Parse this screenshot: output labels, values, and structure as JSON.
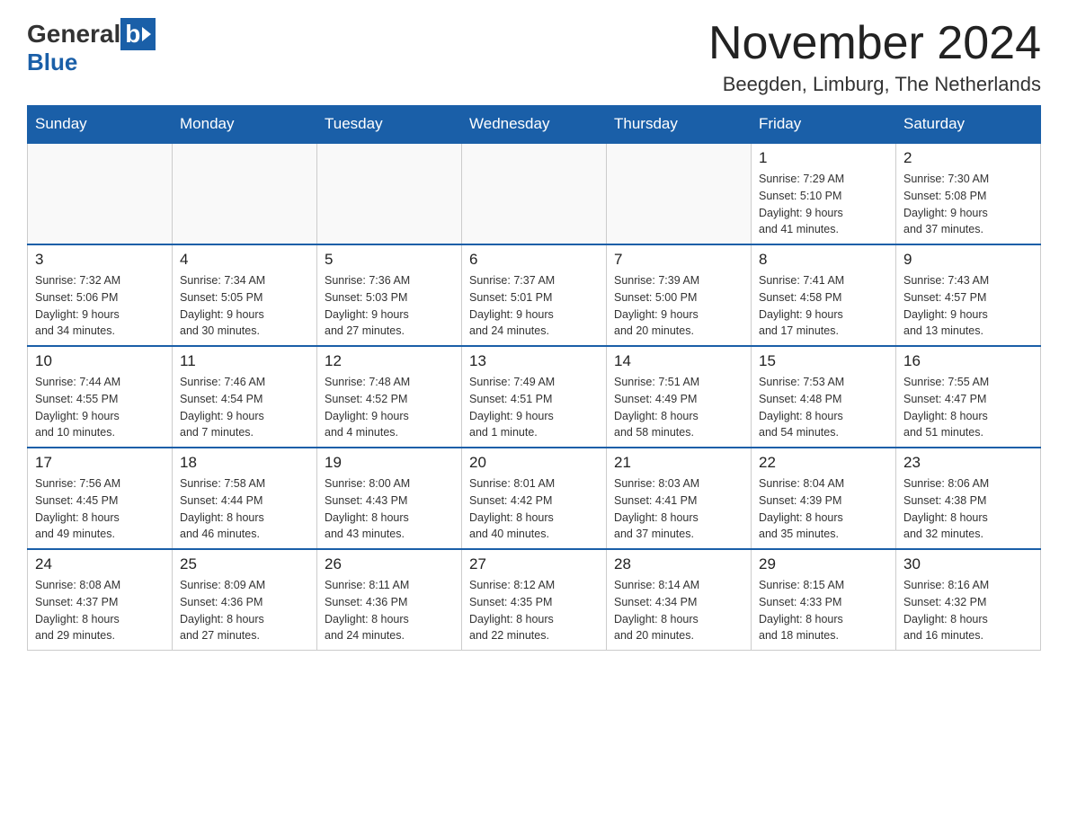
{
  "header": {
    "logo_general": "General",
    "logo_blue": "Blue",
    "month_title": "November 2024",
    "location": "Beegden, Limburg, The Netherlands"
  },
  "days_of_week": [
    "Sunday",
    "Monday",
    "Tuesday",
    "Wednesday",
    "Thursday",
    "Friday",
    "Saturday"
  ],
  "weeks": [
    [
      {
        "day": "",
        "info": ""
      },
      {
        "day": "",
        "info": ""
      },
      {
        "day": "",
        "info": ""
      },
      {
        "day": "",
        "info": ""
      },
      {
        "day": "",
        "info": ""
      },
      {
        "day": "1",
        "info": "Sunrise: 7:29 AM\nSunset: 5:10 PM\nDaylight: 9 hours\nand 41 minutes."
      },
      {
        "day": "2",
        "info": "Sunrise: 7:30 AM\nSunset: 5:08 PM\nDaylight: 9 hours\nand 37 minutes."
      }
    ],
    [
      {
        "day": "3",
        "info": "Sunrise: 7:32 AM\nSunset: 5:06 PM\nDaylight: 9 hours\nand 34 minutes."
      },
      {
        "day": "4",
        "info": "Sunrise: 7:34 AM\nSunset: 5:05 PM\nDaylight: 9 hours\nand 30 minutes."
      },
      {
        "day": "5",
        "info": "Sunrise: 7:36 AM\nSunset: 5:03 PM\nDaylight: 9 hours\nand 27 minutes."
      },
      {
        "day": "6",
        "info": "Sunrise: 7:37 AM\nSunset: 5:01 PM\nDaylight: 9 hours\nand 24 minutes."
      },
      {
        "day": "7",
        "info": "Sunrise: 7:39 AM\nSunset: 5:00 PM\nDaylight: 9 hours\nand 20 minutes."
      },
      {
        "day": "8",
        "info": "Sunrise: 7:41 AM\nSunset: 4:58 PM\nDaylight: 9 hours\nand 17 minutes."
      },
      {
        "day": "9",
        "info": "Sunrise: 7:43 AM\nSunset: 4:57 PM\nDaylight: 9 hours\nand 13 minutes."
      }
    ],
    [
      {
        "day": "10",
        "info": "Sunrise: 7:44 AM\nSunset: 4:55 PM\nDaylight: 9 hours\nand 10 minutes."
      },
      {
        "day": "11",
        "info": "Sunrise: 7:46 AM\nSunset: 4:54 PM\nDaylight: 9 hours\nand 7 minutes."
      },
      {
        "day": "12",
        "info": "Sunrise: 7:48 AM\nSunset: 4:52 PM\nDaylight: 9 hours\nand 4 minutes."
      },
      {
        "day": "13",
        "info": "Sunrise: 7:49 AM\nSunset: 4:51 PM\nDaylight: 9 hours\nand 1 minute."
      },
      {
        "day": "14",
        "info": "Sunrise: 7:51 AM\nSunset: 4:49 PM\nDaylight: 8 hours\nand 58 minutes."
      },
      {
        "day": "15",
        "info": "Sunrise: 7:53 AM\nSunset: 4:48 PM\nDaylight: 8 hours\nand 54 minutes."
      },
      {
        "day": "16",
        "info": "Sunrise: 7:55 AM\nSunset: 4:47 PM\nDaylight: 8 hours\nand 51 minutes."
      }
    ],
    [
      {
        "day": "17",
        "info": "Sunrise: 7:56 AM\nSunset: 4:45 PM\nDaylight: 8 hours\nand 49 minutes."
      },
      {
        "day": "18",
        "info": "Sunrise: 7:58 AM\nSunset: 4:44 PM\nDaylight: 8 hours\nand 46 minutes."
      },
      {
        "day": "19",
        "info": "Sunrise: 8:00 AM\nSunset: 4:43 PM\nDaylight: 8 hours\nand 43 minutes."
      },
      {
        "day": "20",
        "info": "Sunrise: 8:01 AM\nSunset: 4:42 PM\nDaylight: 8 hours\nand 40 minutes."
      },
      {
        "day": "21",
        "info": "Sunrise: 8:03 AM\nSunset: 4:41 PM\nDaylight: 8 hours\nand 37 minutes."
      },
      {
        "day": "22",
        "info": "Sunrise: 8:04 AM\nSunset: 4:39 PM\nDaylight: 8 hours\nand 35 minutes."
      },
      {
        "day": "23",
        "info": "Sunrise: 8:06 AM\nSunset: 4:38 PM\nDaylight: 8 hours\nand 32 minutes."
      }
    ],
    [
      {
        "day": "24",
        "info": "Sunrise: 8:08 AM\nSunset: 4:37 PM\nDaylight: 8 hours\nand 29 minutes."
      },
      {
        "day": "25",
        "info": "Sunrise: 8:09 AM\nSunset: 4:36 PM\nDaylight: 8 hours\nand 27 minutes."
      },
      {
        "day": "26",
        "info": "Sunrise: 8:11 AM\nSunset: 4:36 PM\nDaylight: 8 hours\nand 24 minutes."
      },
      {
        "day": "27",
        "info": "Sunrise: 8:12 AM\nSunset: 4:35 PM\nDaylight: 8 hours\nand 22 minutes."
      },
      {
        "day": "28",
        "info": "Sunrise: 8:14 AM\nSunset: 4:34 PM\nDaylight: 8 hours\nand 20 minutes."
      },
      {
        "day": "29",
        "info": "Sunrise: 8:15 AM\nSunset: 4:33 PM\nDaylight: 8 hours\nand 18 minutes."
      },
      {
        "day": "30",
        "info": "Sunrise: 8:16 AM\nSunset: 4:32 PM\nDaylight: 8 hours\nand 16 minutes."
      }
    ]
  ]
}
